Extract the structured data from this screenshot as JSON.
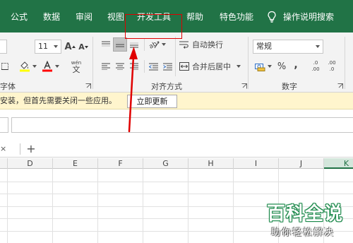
{
  "ribbon_tabs": [
    {
      "id": "formulas",
      "label": "公式"
    },
    {
      "id": "data",
      "label": "数据"
    },
    {
      "id": "review",
      "label": "审阅"
    },
    {
      "id": "view",
      "label": "视图"
    },
    {
      "id": "developer",
      "label": "开发工具"
    },
    {
      "id": "help",
      "label": "帮助"
    },
    {
      "id": "special",
      "label": "特色功能"
    },
    {
      "id": "tellme",
      "label": "操作说明搜索"
    }
  ],
  "font_group": {
    "size_value": "11",
    "label": "字体",
    "icons": [
      "increase-font-icon",
      "decrease-font-icon",
      "fill-color-icon",
      "font-color-icon",
      "phonetic-icon"
    ],
    "fill_color": "#ffff00",
    "font_color": "#ff0000",
    "phonetic_glyph": "wén",
    "phonetic_char": "文"
  },
  "font_size_ups": {
    "increase": "A",
    "decrease": "A"
  },
  "alignment_group": {
    "wrap_text_label": "自动换行",
    "merge_center_label": "合并后居中",
    "label": "对齐方式"
  },
  "number_group": {
    "format_value": "常规",
    "percent_symbol": "%",
    "comma_symbol": ",",
    "increase_decimal": ".00",
    "decrease_decimal": ".0",
    "label": "数字"
  },
  "message_bar": {
    "text": "安装，但首先需要关闭一些应用。",
    "update_button": "立即更新"
  },
  "sheet_tabs": {
    "close": "×",
    "add": "+"
  },
  "columns": [
    "D",
    "E",
    "F",
    "G",
    "H",
    "I",
    "J",
    "K"
  ],
  "selected_column": "K",
  "watermark": {
    "logo": "百科全说",
    "tagline": "助你轻松解决"
  },
  "colors": {
    "ribbon_tab_bg": "#217346",
    "ribbon_bg": "#f3f3f3",
    "message_bar_bg": "#fff5cd",
    "highlight_box": "#e00000",
    "arrow": "#e00000",
    "watermark_green": "#1e8a4c"
  }
}
